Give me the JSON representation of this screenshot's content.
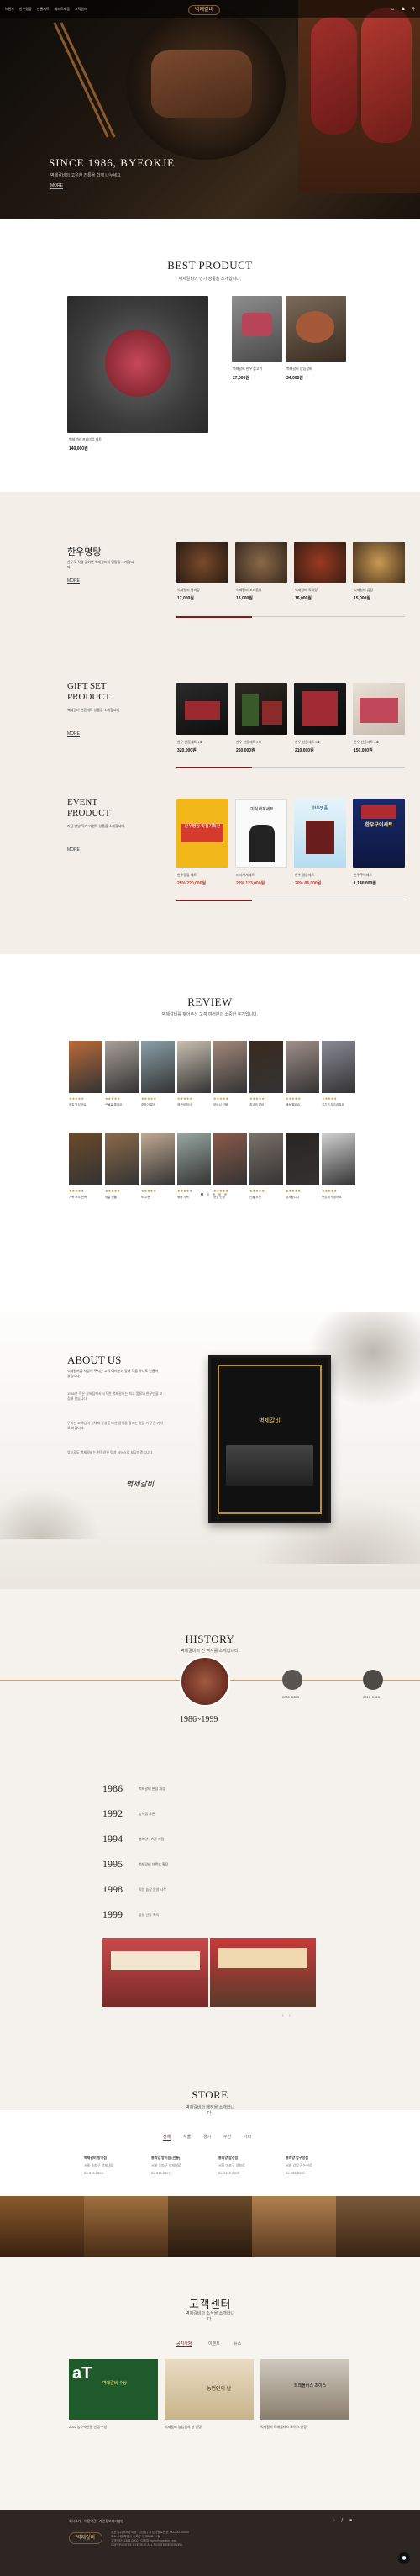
{
  "header": {
    "menu": [
      "브랜드",
      "한우명탕",
      "선물세트",
      "베스트제품",
      "고객센터"
    ],
    "logo": "벽제갈비"
  },
  "hero": {
    "title": "SINCE 1986, BYEOKJE",
    "subtitle": "벽제갈비의 고유한 전통을 함께 나누세요",
    "more": "MORE"
  },
  "best": {
    "title": "BEST PRODUCT",
    "subtitle": "벽제갈비의 인기 상품을 소개합니다.",
    "main_item": {
      "name": "벽제갈비 프리미엄 세트",
      "price": "140,000원"
    },
    "items": [
      {
        "name": "벽제갈비 한우 불고기",
        "price": "27,000원"
      },
      {
        "name": "벽제갈비 양념갈비",
        "price": "34,000원"
      }
    ]
  },
  "hanwoo": {
    "title": "한우명탕",
    "subtitle": "한우로 직접 끓여낸 벽제갈비의 명탕을 소개합니다.",
    "more": "MORE",
    "items": [
      {
        "name": "벽제갈비 갈비탕",
        "price": "17,000원"
      },
      {
        "name": "벽제갈비 꼬리곰탕",
        "price": "18,000원"
      },
      {
        "name": "벽제갈비 육개장",
        "price": "16,000원"
      },
      {
        "name": "벽제갈비 곰탕",
        "price": "15,000원"
      }
    ]
  },
  "gift": {
    "title": "GIFT SET PRODUCT",
    "subtitle": "벽제갈비 선물세트 상품을 소개합니다.",
    "more": "MORE",
    "items": [
      {
        "name": "한우 선물세트 1호",
        "price": "320,000원"
      },
      {
        "name": "한우 선물세트 2호",
        "price": "260,000원"
      },
      {
        "name": "한우 선물세트 3호",
        "price": "210,000원"
      },
      {
        "name": "한우 선물세트 4호",
        "price": "150,000원"
      }
    ]
  },
  "event": {
    "title": "EVENT PRODUCT",
    "subtitle": "지금 만날 특가 이벤트 상품을 소개합니다.",
    "more": "MORE",
    "items": [
      {
        "name": "한우명탕 세트",
        "price": "25% 220,000원",
        "banner": "한우명탕 맛집기획전"
      },
      {
        "name": "미식세계세트",
        "price": "22% 123,000원",
        "banner": "미식세계세트"
      },
      {
        "name": "한우 명품세트",
        "price": "20% 84,000원",
        "banner": "한우명품"
      },
      {
        "name": "한우구이세트",
        "price": "1,140,000원",
        "banner": "한우구이세트"
      }
    ]
  },
  "review": {
    "title": "REVIEW",
    "subtitle": "벽제갈비를 찾아주신 고객 여러분의 소중한 후기입니다.",
    "rows": [
      [
        {
          "text": "정말 맛있어요"
        },
        {
          "text": "선물로 좋아요"
        },
        {
          "text": "포장이 깔끔"
        },
        {
          "text": "재구매 의사"
        },
        {
          "text": "부모님 선물"
        },
        {
          "text": "최고의 갈비"
        },
        {
          "text": "배송 빨라요"
        },
        {
          "text": "고기가 부드러워요"
        }
      ],
      [
        {
          "text": "가족 모두 만족"
        },
        {
          "text": "명절 선물"
        },
        {
          "text": "또 주문"
        },
        {
          "text": "육즙 가득"
        },
        {
          "text": "맛집 인정"
        },
        {
          "text": "선물 추천"
        },
        {
          "text": "감사합니다"
        },
        {
          "text": "맛있게 먹었어요"
        }
      ]
    ],
    "stars": "★★★★★"
  },
  "about": {
    "title": "ABOUT US",
    "subtitle": "벽제갈비를 사랑해 주시는 고객 여러분과 맛과 격을 하나로 만들어왔습니다.",
    "paragraphs": [
      "1986년 작은 갈비집에서 시작한 벽제갈비는 최고 품질의 한우만을 고집해 왔습니다.",
      "우리는 고객님의 식탁에 정성을 다한 음식을 올리는 것을 가장 큰 가치로 여깁니다.",
      "앞으로도 벽제갈비는 한결같은 맛과 서비스로 보답하겠습니다."
    ],
    "signature": "벽제갈비",
    "frame_logo": "벽제갈비"
  },
  "history": {
    "title": "HISTORY",
    "subtitle": "벽제갈비의 긴 역사를 소개합니다.",
    "current": "1986~1999",
    "periods": [
      "2000~2009",
      "2010~2019"
    ],
    "years": [
      {
        "year": "1986",
        "desc": "벽제갈비 본점 개점"
      },
      {
        "year": "1992",
        "desc": "방이점 오픈"
      },
      {
        "year": "1994",
        "desc": "봉피양 1호점 개점"
      },
      {
        "year": "1995",
        "desc": "벽제갈비 브랜드 확장"
      },
      {
        "year": "1998",
        "desc": "직영 농장 운영 시작"
      },
      {
        "year": "1999",
        "desc": "품질 인증 획득"
      }
    ]
  },
  "store": {
    "title": "STORE",
    "subtitle": "벽제갈비의 매장을 소개합니다.",
    "tabs": [
      "전체",
      "서울",
      "경기",
      "부산",
      "기타"
    ],
    "stores": [
      {
        "name": "벽제갈비 방이점",
        "addr": "서울 송파구 양재대로",
        "tel": "02-415-5522"
      },
      {
        "name": "봉피양 방이점 (전통)",
        "addr": "서울 송파구 양재대로",
        "tel": "02-415-5527"
      },
      {
        "name": "봉피양 합정점",
        "addr": "서울 마포구 양화로",
        "tel": "02-3144-2929"
      },
      {
        "name": "봉피양 압구정점",
        "addr": "서울 강남구 논현로",
        "tel": "02-548-5292"
      }
    ]
  },
  "cs": {
    "title": "고객센터",
    "subtitle": "벽제갈비의 소식을 소개합니다.",
    "tabs": [
      "공지사항",
      "이벤트",
      "뉴스"
    ],
    "posts": [
      {
        "title": "2022 농수축산물 선정 수상",
        "badge": "벽제갈비 수상"
      },
      {
        "title": "벽제갈비 농업인의 날 선정",
        "badge": "농업인의 날"
      },
      {
        "title": "벽제갈비 트래블러스 초이스 선정",
        "badge": "트래블러스 초이스"
      }
    ]
  },
  "footer": {
    "links": [
      "회사소개",
      "이용약관",
      "개인정보처리방침"
    ],
    "logo": "벽제갈비",
    "info": [
      "상호: (주)벽제 | 대표: 김영환 | 사업자등록번호: 000-00-00000",
      "주소: 서울특별시 송파구 양재대로 71길",
      "고객센터: 1588-0000 | 이메일: help@byeokje.com",
      "COPYRIGHT © BYEOKJE ALL RIGHTS RESERVED."
    ]
  },
  "colors": {
    "accent": "#7b1d1d",
    "gold": "#c9a47a",
    "beige": "#f3efe8",
    "dark": "#2d2622"
  }
}
